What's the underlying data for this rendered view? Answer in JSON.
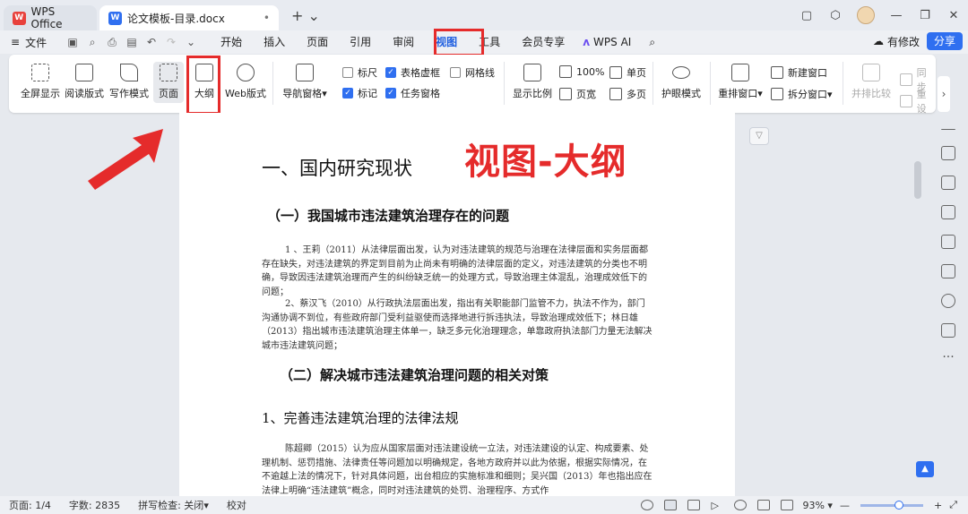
{
  "titlebar": {
    "home_tab": "WPS Office",
    "doc_tab": "论文模板-目录.docx",
    "home_logo": "W",
    "doc_logo": "W"
  },
  "menubar": {
    "file": "文件",
    "items": [
      "开始",
      "插入",
      "页面",
      "引用",
      "审阅",
      "视图",
      "工具",
      "会员专享"
    ],
    "active": "视图",
    "ai": "WPS AI",
    "edit": "有修改",
    "share": "分享"
  },
  "ribbon": {
    "buttons": {
      "fullscreen": "全屏显示",
      "reading": "阅读版式",
      "writing": "写作模式",
      "page": "页面",
      "outline": "大纲",
      "web": "Web版式",
      "nav": "导航窗格",
      "ratio": "显示比例",
      "eyecare": "护眼模式",
      "rearrange": "重排窗口",
      "compare": "并排比较"
    },
    "checkboxes": [
      {
        "label": "标尺",
        "checked": false
      },
      {
        "label": "表格虚框",
        "checked": true
      },
      {
        "label": "网格线",
        "checked": false
      },
      {
        "label": "标记",
        "checked": true
      },
      {
        "label": "任务窗格",
        "checked": true
      }
    ],
    "small": {
      "zoom100": "100%",
      "single": "单页",
      "pagewidth": "页宽",
      "multi": "多页",
      "newwin": "新建窗口",
      "splitwin": "拆分窗口",
      "sync": "同步",
      "reset": "重设"
    }
  },
  "document": {
    "heading1": "一、国内研究现状",
    "annotation": "视图-大纲",
    "section1": "（一）我国城市违法建筑治理存在的问题",
    "para1": "1 、王莉（2011）从法律层面出发，认为对违法建筑的规范与治理在法律层面和实务层面都存在缺失，对违法建筑的界定到目前为止尚未有明确的法律层面的定义，对违法建筑的分类也不明确，导致因违法建筑治理而产生的纠纷缺乏统一的处理方式，导致治理主体混乱，治理成效低下的问题；",
    "para2": "2、蔡汉飞（2010）从行政执法层面出发，指出有关职能部门监管不力，执法不作为，部门沟通协调不到位，有些政府部门受利益驱使而选择地进行拆违执法，导致治理成效低下；林日雄（2013）指出城市违法建筑治理主体单一，缺乏多元化治理理念，单靠政府执法部门力量无法解决城市违法建筑问题；",
    "section2": "（二）解决城市违法建筑治理问题的相关对策",
    "sub1": "1、完善违法建筑治理的法律法规",
    "para3": "陈超卿（2015）认为应从国家层面对违法建设统一立法，对违法建设的认定、构成要素、处理机制、惩罚措施、法律责任等问题加以明确规定，各地方政府并以此为依据，根据实际情况，在不逾越上法的情况下，针对具体问题，出台相应的实施标准和细则；吴兴国（2013）年也指出应在法律上明确“违法建筑”概念，同时对违法建筑的处罚、治理程序、方式作"
  },
  "status": {
    "page": "页面: 1/4",
    "words": "字数: 2835",
    "spell": "拼写检查: 关闭",
    "proof": "校对",
    "zoom": "93%"
  },
  "colors": {
    "accent": "#2f6ff0",
    "highlight_red": "#e52b2b"
  },
  "icons": [
    "fullscreen-icon",
    "reading-icon",
    "writing-icon",
    "page-icon",
    "outline-icon",
    "web-icon",
    "nav-icon",
    "ratio-icon",
    "eye-icon",
    "rearrange-icon",
    "compare-icon"
  ]
}
